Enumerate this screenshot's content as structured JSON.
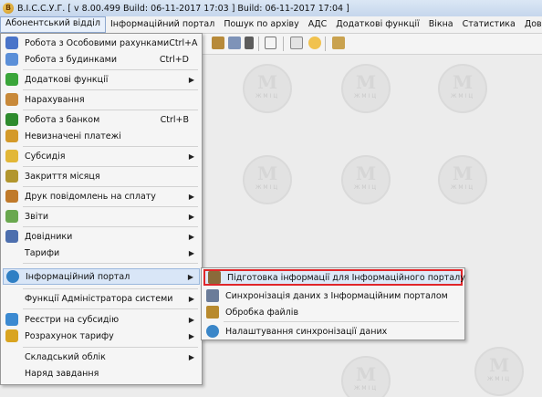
{
  "window": {
    "title": "В.І.С.С.У.Г. [ v 8.00.499 Build: 06-11-2017 17:03 ]   Build: 06-11-2017 17:04 ]",
    "app_icon_letter": "В"
  },
  "menubar": [
    "Абонентський відділ",
    "Інформаційний портал",
    "Пошук по архіву",
    "АДС",
    "Додаткові функції",
    "Вікна",
    "Статистика",
    "Довідка"
  ],
  "watermark": {
    "text": "ЖМІЦ"
  },
  "main_menu": [
    {
      "label": "Робота з Особовими рахунками",
      "shortcut": "Ctrl+A",
      "icon": "people-icon",
      "color": "#4a74c9"
    },
    {
      "label": "Робота з будинками",
      "shortcut": "Ctrl+D",
      "icon": "house-icon",
      "color": "#5b8fd8"
    },
    {
      "label": "Додаткові функції",
      "submenu": true,
      "icon": "plus-icon",
      "color": "#3aa53a"
    },
    {
      "label": "Нарахування",
      "icon": "calculator-icon",
      "color": "#c8893a"
    },
    {
      "label": "Робота з банком",
      "shortcut": "Ctrl+B",
      "icon": "dollar-icon",
      "color": "#2e8b2e"
    },
    {
      "label": "Невизначені платежі",
      "icon": "question-money-icon",
      "color": "#d49a2a"
    },
    {
      "label": "Субсидія",
      "submenu": true,
      "icon": "coins-icon",
      "color": "#e2b737"
    },
    {
      "label": "Закриття місяця",
      "icon": "lock-icon",
      "color": "#b2962e"
    },
    {
      "label": "Друк повідомлень на сплату",
      "submenu": true,
      "icon": "printer-icon",
      "color": "#c07a2a"
    },
    {
      "label": "Звіти",
      "submenu": true,
      "icon": "report-icon",
      "color": "#6aa84f"
    },
    {
      "label": "Довідники",
      "submenu": true,
      "icon": "book-icon",
      "color": "#4d6fae"
    },
    {
      "label": "Тарифи",
      "submenu": true,
      "icon": "",
      "color": ""
    },
    {
      "label": "Інформаційний портал",
      "submenu": true,
      "icon": "globe-icon",
      "color": "#2f7fc4",
      "highlight": true
    },
    {
      "label": "Функції Адміністратора системи",
      "submenu": true,
      "icon": "",
      "color": ""
    },
    {
      "label": "Реєстри на субсидію",
      "submenu": true,
      "icon": "registry-icon",
      "color": "#3c8ad1"
    },
    {
      "label": "Розрахунок тарифу",
      "submenu": true,
      "icon": "tariff-icon",
      "color": "#d9a420"
    },
    {
      "label": "Складський облік",
      "submenu": true,
      "icon": "",
      "color": ""
    },
    {
      "label": "Наряд завдання",
      "icon": "",
      "color": ""
    }
  ],
  "submenu": [
    {
      "label": "Підготовка інформації для Інформаційного порталу",
      "icon": "prepare-icon",
      "color": "#8a6a3a",
      "highlight": true
    },
    {
      "label": "Синхронізація даних з Інформаційним порталом",
      "icon": "sync-icon",
      "color": "#6b7c99"
    },
    {
      "label": "Обробка файлів",
      "icon": "files-icon",
      "color": "#b88a2e"
    },
    {
      "label": "Налаштування синхронізації даних",
      "icon": "settings-sync-icon",
      "color": "#3a86c8"
    }
  ]
}
